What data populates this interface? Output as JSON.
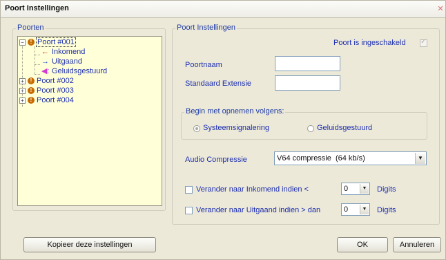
{
  "window": {
    "title": "Poort Instellingen"
  },
  "left_group": {
    "legend": "Poorten",
    "tree": [
      {
        "label": "Poort #001",
        "expanded": true,
        "selected": true,
        "children": [
          {
            "label": "Inkomend",
            "icon": "arrow-left-icon",
            "icon_color": "#cc1a1a"
          },
          {
            "label": "Uitgaand",
            "icon": "arrow-right-icon",
            "icon_color": "#1a4ed0"
          },
          {
            "label": "Geluidsgestuurd",
            "icon": "speaker-icon",
            "icon_color": "#d23ad2"
          }
        ]
      },
      {
        "label": "Poort #002",
        "expanded": false
      },
      {
        "label": "Poort #003",
        "expanded": false
      },
      {
        "label": "Poort #004",
        "expanded": false
      }
    ]
  },
  "right_group": {
    "legend": "Poort Instellingen",
    "enabled_label": "Poort is ingeschakeld",
    "name_label": "Poortnaam",
    "name_value": "",
    "extension_label": "Standaard Extensie",
    "extension_value": "",
    "record_group": {
      "legend": "Begin met opnemen volgens:",
      "options": [
        "Systeemsignalering",
        "Geluidsgestuurd"
      ],
      "selected": "Systeemsignalering"
    },
    "audio_label": "Audio Compressie",
    "audio_value": "V64 compressie  (64 kb/s)",
    "incoming_label": "Verander naar Inkomend indien <",
    "incoming_value": "0",
    "outgoing_label": "Verander naar Uitgaand indien > dan",
    "outgoing_value": "0",
    "digits_label": "Digits"
  },
  "buttons": {
    "copy": "Kopieer deze instellingen",
    "ok": "OK",
    "cancel": "Annuleren"
  }
}
